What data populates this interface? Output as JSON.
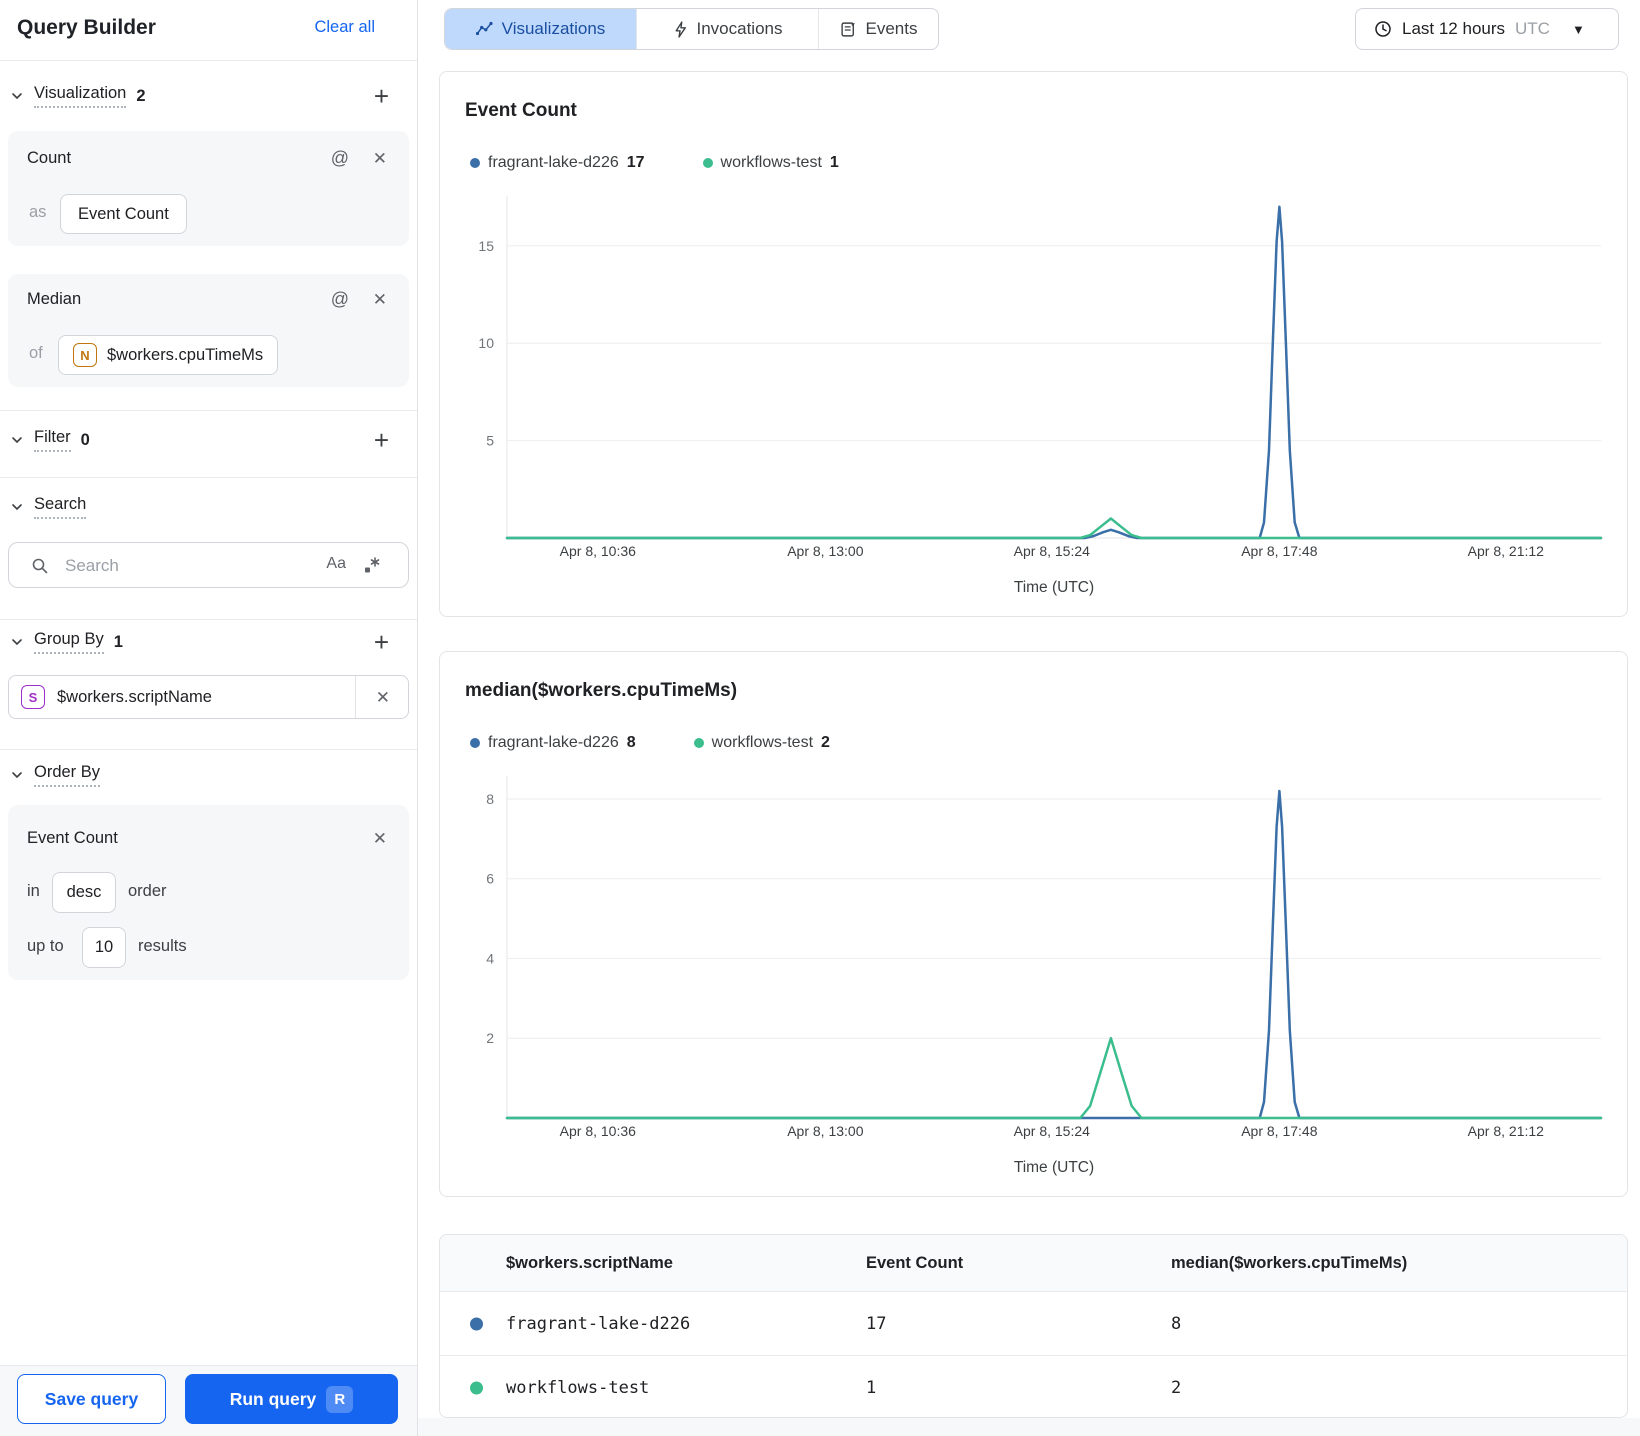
{
  "sidebar": {
    "title": "Query Builder",
    "clear_all_label": "Clear all",
    "visualization_section": {
      "label": "Visualization",
      "count": "2",
      "add_icon": "+"
    },
    "count_card": {
      "title": "Count",
      "at_icon": "@",
      "close_icon": "✕",
      "as_label": "as",
      "as_value": "Event Count"
    },
    "median_card": {
      "title": "Median",
      "at_icon": "@",
      "close_icon": "✕",
      "of_label": "of",
      "field_badge": "N",
      "field_value": "$workers.cpuTimeMs"
    },
    "filter_section": {
      "label": "Filter",
      "count": "0",
      "add_icon": "+"
    },
    "search_section": {
      "label": "Search"
    },
    "search_input": {
      "placeholder": "Search",
      "case_icon_label": "Aa"
    },
    "group_by_section": {
      "label": "Group By",
      "count": "1",
      "add_icon": "+"
    },
    "group_by_item": {
      "badge": "S",
      "field_value": "$workers.scriptName",
      "close_icon": "✕"
    },
    "order_by_section": {
      "label": "Order By"
    },
    "order_by_card": {
      "title": "Event Count",
      "close_icon": "✕",
      "in_label": "in",
      "direction_value": "desc",
      "order_label": "order",
      "up_to_label": "up to",
      "limit_value": "10",
      "results_label": "results"
    },
    "footer": {
      "save_label": "Save query",
      "run_label": "Run query",
      "run_shortcut": "R"
    }
  },
  "topbar": {
    "tabs": [
      {
        "label": "Visualizations",
        "selected": true
      },
      {
        "label": "Invocations",
        "selected": false
      },
      {
        "label": "Events",
        "selected": false
      }
    ],
    "time_range": {
      "label": "Last 12 hours",
      "timezone": "UTC"
    }
  },
  "chart_data": [
    {
      "type": "line",
      "title": "Event Count",
      "xlabel": "Time (UTC)",
      "grid": true,
      "legend_position": "top-left",
      "ylim": [
        0,
        17.3
      ],
      "y_ticks": [
        5,
        10,
        15
      ],
      "x_ticks": [
        {
          "pos": 0.083,
          "label": "Apr 8, 10:36"
        },
        {
          "pos": 0.291,
          "label": "Apr 8, 13:00"
        },
        {
          "pos": 0.498,
          "label": "Apr 8, 15:24"
        },
        {
          "pos": 0.706,
          "label": "Apr 8, 17:48"
        },
        {
          "pos": 0.913,
          "label": "Apr 8, 21:12"
        }
      ],
      "legend": [
        {
          "name": "fragrant-lake-d226",
          "value": "17"
        },
        {
          "name": "workflows-test",
          "value": "1"
        }
      ],
      "series": [
        {
          "name": "fragrant-lake-d226",
          "color": "#3A6FA8",
          "points": [
            [
              0,
              0
            ],
            [
              0.528,
              0
            ],
            [
              0.536,
              0.1
            ],
            [
              0.545,
              0.3
            ],
            [
              0.552,
              0.42
            ],
            [
              0.559,
              0.3
            ],
            [
              0.568,
              0.1
            ],
            [
              0.576,
              0
            ],
            [
              0.688,
              0
            ],
            [
              0.692,
              0.8
            ],
            [
              0.6965,
              4.5
            ],
            [
              0.7,
              10
            ],
            [
              0.7035,
              15.2
            ],
            [
              0.706,
              17
            ],
            [
              0.7085,
              15.2
            ],
            [
              0.712,
              10
            ],
            [
              0.7155,
              4.5
            ],
            [
              0.72,
              0.8
            ],
            [
              0.7243,
              0
            ],
            [
              1,
              0
            ]
          ]
        },
        {
          "name": "workflows-test",
          "color": "#3BBD8D",
          "points": [
            [
              0,
              0
            ],
            [
              0.524,
              0
            ],
            [
              0.533,
              0.15
            ],
            [
              0.542,
              0.55
            ],
            [
              0.552,
              1
            ],
            [
              0.562,
              0.55
            ],
            [
              0.571,
              0.15
            ],
            [
              0.58,
              0
            ],
            [
              1,
              0
            ]
          ]
        }
      ]
    },
    {
      "type": "line",
      "title": "median($workers.cpuTimeMs)",
      "xlabel": "Time (UTC)",
      "grid": true,
      "legend_position": "top-left",
      "ylim": [
        0,
        8.45
      ],
      "y_ticks": [
        2,
        4,
        6,
        8
      ],
      "x_ticks": [
        {
          "pos": 0.083,
          "label": "Apr 8, 10:36"
        },
        {
          "pos": 0.291,
          "label": "Apr 8, 13:00"
        },
        {
          "pos": 0.498,
          "label": "Apr 8, 15:24"
        },
        {
          "pos": 0.706,
          "label": "Apr 8, 17:48"
        },
        {
          "pos": 0.913,
          "label": "Apr 8, 21:12"
        }
      ],
      "legend": [
        {
          "name": "fragrant-lake-d226",
          "value": "8"
        },
        {
          "name": "workflows-test",
          "value": "2"
        }
      ],
      "series": [
        {
          "name": "fragrant-lake-d226",
          "color": "#3A6FA8",
          "points": [
            [
              0,
              0
            ],
            [
              0.688,
              0
            ],
            [
              0.692,
              0.4
            ],
            [
              0.6965,
              2.2
            ],
            [
              0.7,
              4.8
            ],
            [
              0.7035,
              7.3
            ],
            [
              0.706,
              8.2
            ],
            [
              0.7085,
              7.3
            ],
            [
              0.712,
              4.8
            ],
            [
              0.7155,
              2.2
            ],
            [
              0.72,
              0.4
            ],
            [
              0.7243,
              0
            ],
            [
              1,
              0
            ]
          ]
        },
        {
          "name": "workflows-test",
          "color": "#3BBD8D",
          "points": [
            [
              0,
              0
            ],
            [
              0.524,
              0
            ],
            [
              0.533,
              0.3
            ],
            [
              0.542,
              1.1
            ],
            [
              0.552,
              2
            ],
            [
              0.562,
              1.1
            ],
            [
              0.571,
              0.3
            ],
            [
              0.58,
              0
            ],
            [
              1,
              0
            ]
          ]
        }
      ]
    }
  ],
  "table": {
    "columns": [
      "$workers.scriptName",
      "Event Count",
      "median($workers.cpuTimeMs)"
    ],
    "rows": [
      {
        "dot_color": "#3A6FA8",
        "script_name": "fragrant-lake-d226",
        "event_count": "17",
        "median": "8"
      },
      {
        "dot_color": "#3BBD8D",
        "script_name": "workflows-test",
        "event_count": "1",
        "median": "2"
      }
    ]
  },
  "colors": {
    "accent_blue": "#1565F0",
    "series_blue": "#3A6FA8",
    "series_green": "#3BBD8D",
    "tab_selected_bg": "#BFD9FC",
    "tab_selected_text": "#1A4FA0",
    "badge_n_orange": "#C1770F",
    "badge_s_purple": "#A02EC9"
  }
}
